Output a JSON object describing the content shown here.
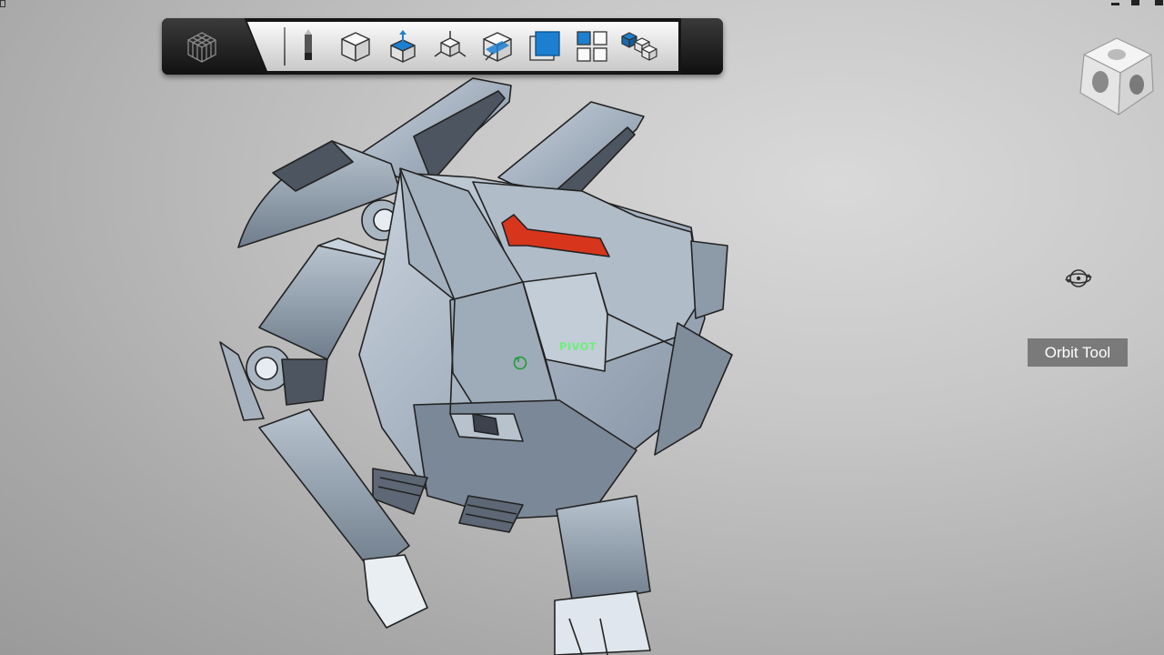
{
  "toolbar": {
    "tools": [
      {
        "id": "appearance",
        "icon": "pencil-icon"
      },
      {
        "id": "view-front",
        "icon": "cube-icon"
      },
      {
        "id": "view-top",
        "icon": "cube-top-face-icon"
      },
      {
        "id": "move",
        "icon": "cube-move-arrows-icon"
      },
      {
        "id": "section",
        "icon": "cube-section-plane-icon"
      },
      {
        "id": "single-view",
        "icon": "single-view-icon"
      },
      {
        "id": "quad-view",
        "icon": "four-view-grid-icon"
      },
      {
        "id": "parts",
        "icon": "assembly-blocks-icon"
      }
    ]
  },
  "viewport": {
    "pivot_label": "PIVOT",
    "tooltip": "Orbit Tool"
  },
  "colors": {
    "accent_blue": "#1d7fd0",
    "pivot_green": "#6cf07a",
    "model_body": "#9aa9b8",
    "model_red": "#d8351d"
  }
}
